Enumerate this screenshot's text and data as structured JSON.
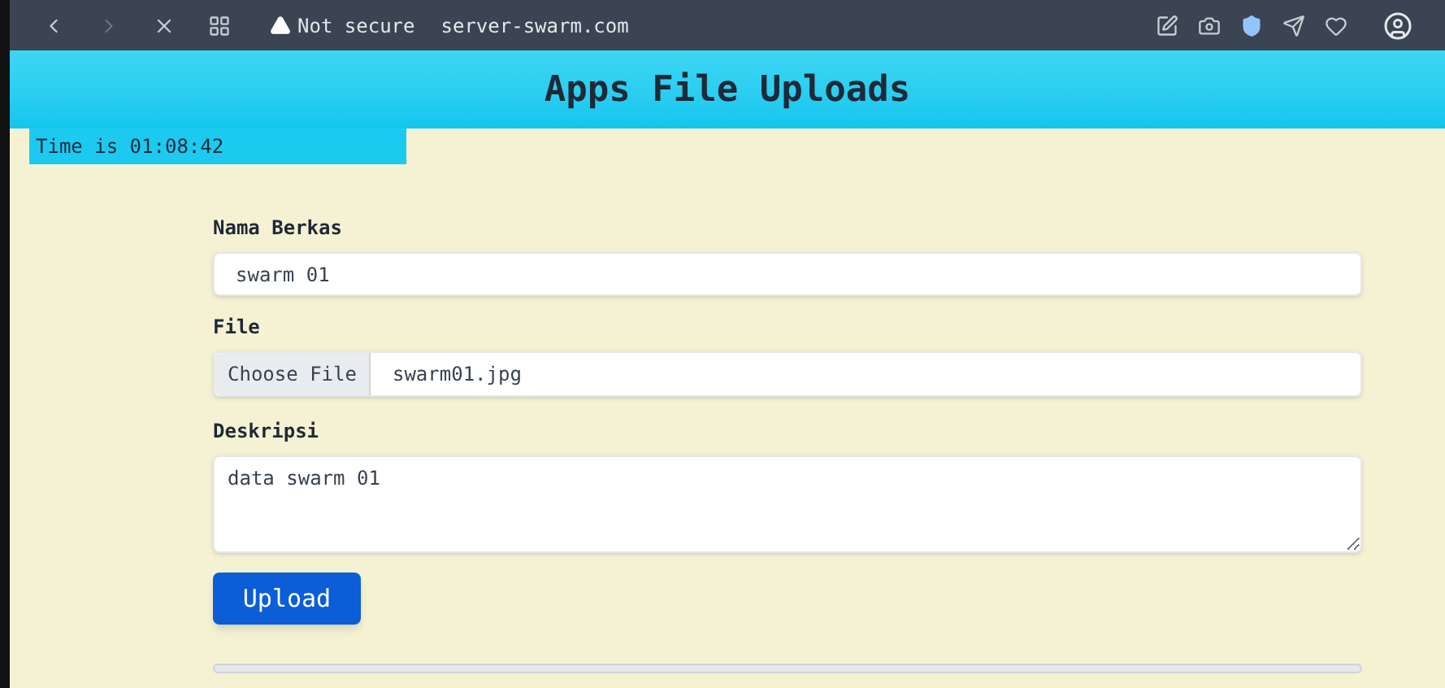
{
  "browser": {
    "security": "Not secure",
    "url": "server-swarm.com"
  },
  "header": {
    "title": "Apps File Uploads"
  },
  "clock": {
    "text": "Time is 01:08:42"
  },
  "form": {
    "name_label": "Nama Berkas",
    "name_value": "swarm 01",
    "file_label": "File",
    "file_button": "Choose File",
    "file_name": "swarm01.jpg",
    "description_label": "Deskripsi",
    "description_value": "data swarm 01",
    "submit": "Upload"
  },
  "progress": {
    "level": 0
  }
}
